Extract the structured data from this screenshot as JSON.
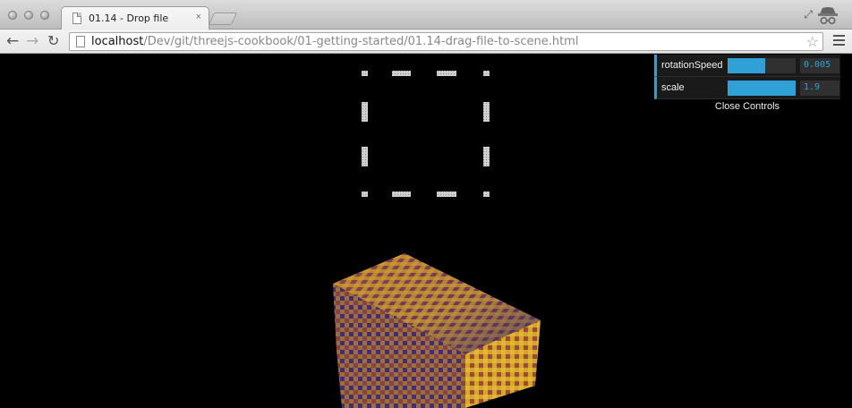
{
  "window": {
    "tab_title": "01.14 - Drop file",
    "tab_close": "×"
  },
  "toolbar": {
    "url_host": "localhost",
    "url_path": "/Dev/git/threejs-cookbook/01-getting-started/01.14-drag-file-to-scene.html",
    "back_glyph": "←",
    "forward_glyph": "→",
    "reload_glyph": "↻",
    "star_glyph": "☆"
  },
  "icons": {
    "tab": "page-icon",
    "omnibox": "page-icon",
    "bookmark": "star-icon",
    "menu": "hamburger-menu-icon",
    "profile": "incognito-icon"
  },
  "gui": {
    "controls": [
      {
        "label": "rotationSpeed",
        "value": "0.005",
        "fill": 0.55
      },
      {
        "label": "scale",
        "value": "1.9",
        "fill": 1.0
      }
    ],
    "close_label": "Close Controls",
    "accent": "#2fa1d6"
  },
  "scene": {
    "background": "#000000",
    "drop_box_color": "#d9d9d9",
    "cube_colors": [
      "#c9a227",
      "#8a3a5e",
      "#3f2f6b",
      "#d14a2a"
    ]
  }
}
